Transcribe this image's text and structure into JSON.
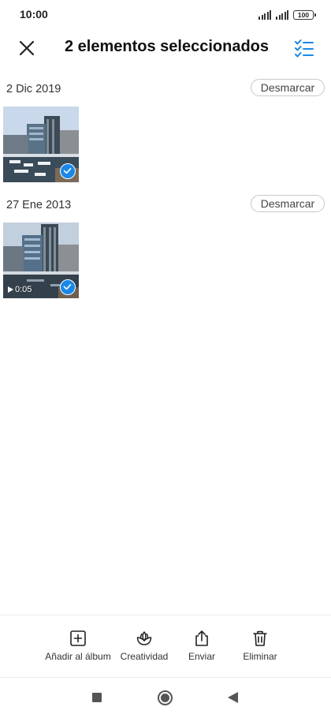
{
  "status_bar": {
    "time": "10:00",
    "battery": "100"
  },
  "header": {
    "title": "2 elementos seleccionados",
    "close_icon": "close-icon",
    "select_all_icon": "checklist-icon"
  },
  "groups": [
    {
      "date": "2 Dic 2019",
      "unmark_label": "Desmarcar",
      "items": [
        {
          "type": "photo",
          "selected": true
        }
      ]
    },
    {
      "date": "27 Ene 2013",
      "unmark_label": "Desmarcar",
      "items": [
        {
          "type": "video",
          "duration": "0:05",
          "selected": true
        }
      ]
    }
  ],
  "actions": [
    {
      "label": "Añadir al álbum",
      "icon": "add-to-album-icon"
    },
    {
      "label": "Creatividad",
      "icon": "lotus-icon"
    },
    {
      "label": "Enviar",
      "icon": "share-icon"
    },
    {
      "label": "Eliminar",
      "icon": "trash-icon"
    }
  ],
  "colors": {
    "accent": "#1a88e8",
    "text": "#111111"
  }
}
